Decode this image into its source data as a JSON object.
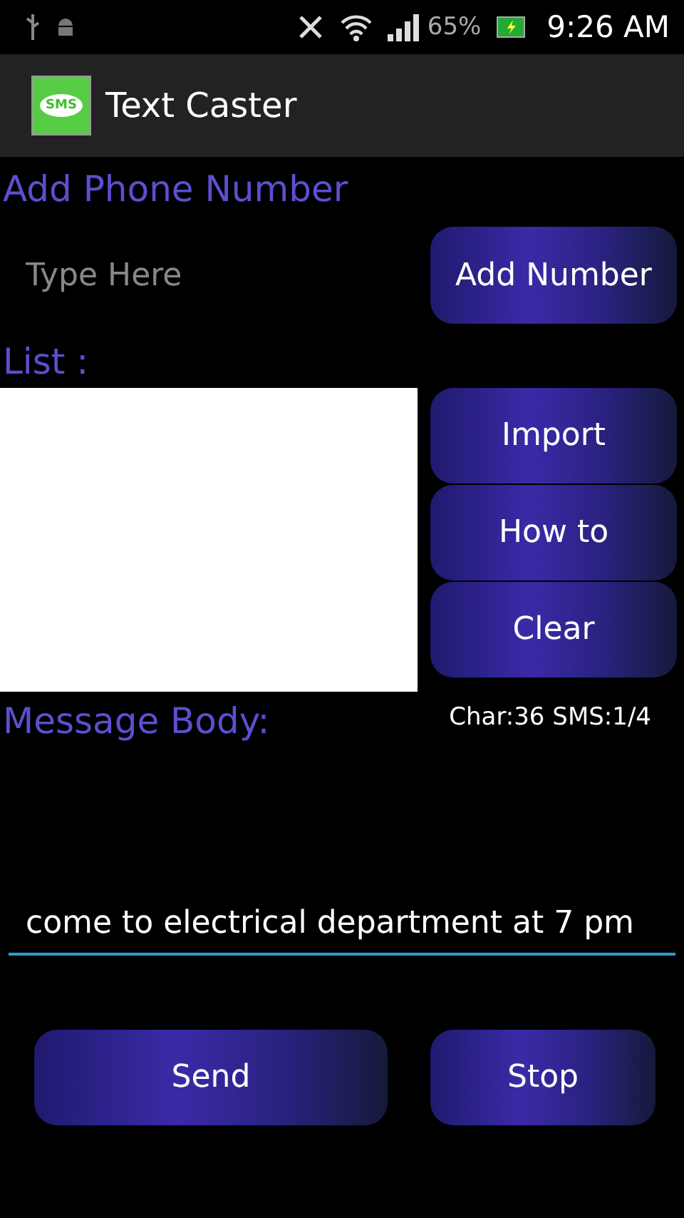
{
  "status_bar": {
    "battery": "65%",
    "time": "9:26 AM"
  },
  "app_bar": {
    "title": "Text Caster",
    "icon_text": "SMS"
  },
  "phone": {
    "label": "Add Phone Number",
    "placeholder": "Type Here",
    "button": "Add Number"
  },
  "list": {
    "label": "List :",
    "buttons": [
      "Import",
      "How to",
      "Clear"
    ]
  },
  "message": {
    "label": "Message Body:",
    "counter": "Char:36 SMS:1/4",
    "value": "come to electrical department at 7 pm"
  },
  "actions": [
    "Send",
    "Stop"
  ]
}
